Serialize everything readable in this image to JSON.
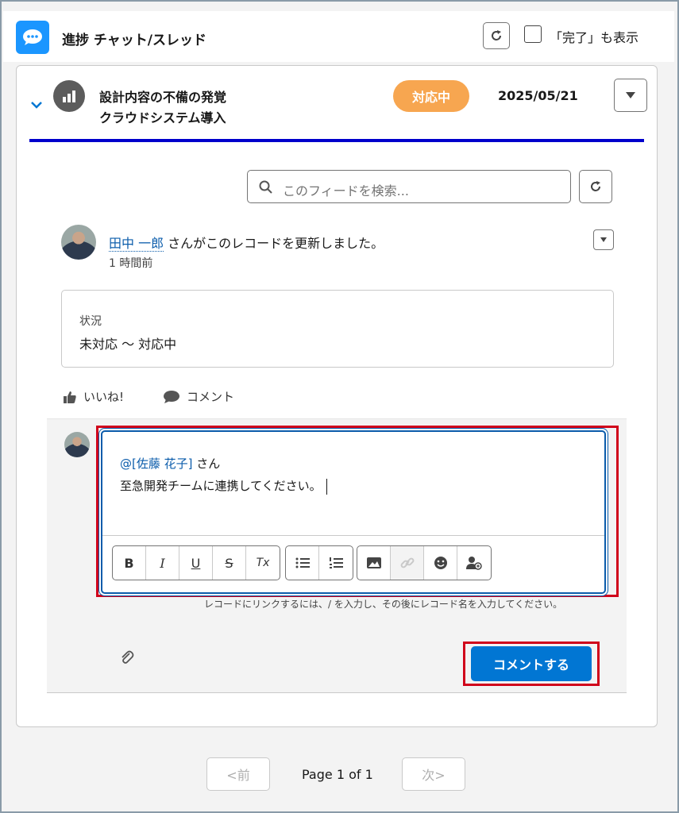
{
  "header": {
    "title": "進捗 チャット/スレッド",
    "show_completed_label": "「完了」も表示",
    "show_completed_checked": false
  },
  "record": {
    "title_line1": "設計内容の不備の発覚",
    "title_line2": "クラウドシステム導入",
    "status": "対応中",
    "date": "2025/05/21"
  },
  "feed": {
    "search_placeholder": "このフィードを検索...",
    "post": {
      "author": "田中 一郎",
      "action_text": " さんがこのレコードを更新しました。",
      "time": "1 時間前",
      "change_label": "状況",
      "change_value": "未対応 〜 対応中"
    },
    "actions": {
      "like": "いいね!",
      "comment": "コメント"
    }
  },
  "composer": {
    "mention": "@[佐藤 花子]",
    "mention_suffix": " さん",
    "body": "至急開発チームに連携してください。",
    "hint": "レコードにリンクするには、/ を入力し、その後にレコード名を入力してください。",
    "submit_label": "コメントする",
    "toolbar": [
      "B",
      "I",
      "U",
      "S",
      "Tx"
    ]
  },
  "pager": {
    "prev_label": "<前",
    "next_label": "次>",
    "page_text": "Page 1 of 1"
  },
  "colors": {
    "brand_blue": "#0176d3",
    "status_orange": "#f7a650",
    "highlight_red": "#d0021b",
    "rule_blue": "#0000cc"
  }
}
